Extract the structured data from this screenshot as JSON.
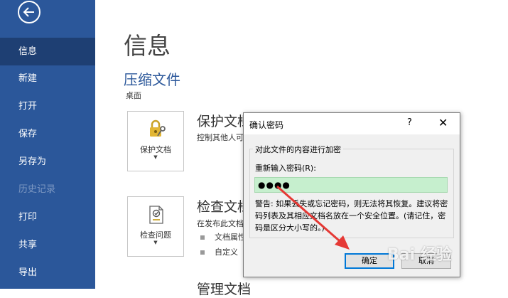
{
  "sidebar": {
    "items": [
      {
        "label": "信息",
        "state": "active"
      },
      {
        "label": "新建",
        "state": "normal"
      },
      {
        "label": "打开",
        "state": "normal"
      },
      {
        "label": "保存",
        "state": "normal"
      },
      {
        "label": "另存为",
        "state": "normal"
      },
      {
        "label": "历史记录",
        "state": "disabled"
      },
      {
        "label": "打印",
        "state": "normal"
      },
      {
        "label": "共享",
        "state": "normal"
      },
      {
        "label": "导出",
        "state": "normal"
      }
    ]
  },
  "main": {
    "title": "信息",
    "doc_name": "压缩文件",
    "doc_location": "桌面",
    "protect": {
      "button_label": "保护文档",
      "title": "保护文档",
      "desc": "控制其他人可"
    },
    "inspect": {
      "button_label": "检查问题",
      "title": "检查文档",
      "desc": "在发布此文档",
      "bullets": [
        "文档属性",
        "自定义"
      ]
    },
    "manage": {
      "title": "管理文档"
    }
  },
  "dialog": {
    "title": "确认密码",
    "help": "?",
    "close": "✕",
    "group_label": "对此文件的内容进行加密",
    "password_label": "重新输入密码(R):",
    "password_value": "●●●●",
    "warning": "警告: 如果丢失或忘记密码，则无法将其恢复。建议将密码列表及其相应文档名放在一个安全位置。(请记住，密码是区分大小写的。)",
    "ok_label": "确定",
    "cancel_label": "取消"
  },
  "watermark": "Bai 经验",
  "colors": {
    "sidebar": "#2b579a",
    "sidebar_active": "#1e3f73",
    "accent": "#2b579a",
    "password_field": "#c6efce",
    "annotation_arrow": "#e53935"
  }
}
